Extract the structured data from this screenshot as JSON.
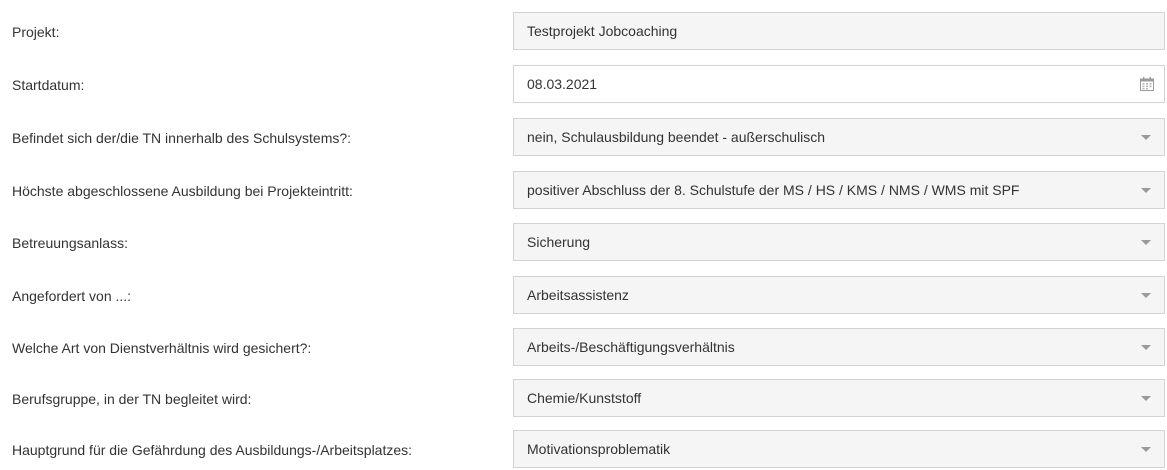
{
  "form": {
    "rows": [
      {
        "label": "Projekt:",
        "value": "Testprojekt Jobcoaching",
        "control": "text",
        "icon": ""
      },
      {
        "label": "Startdatum:",
        "value": "08.03.2021",
        "control": "date",
        "icon": "calendar-icon"
      },
      {
        "label": "Befindet sich der/die TN innerhalb des Schulsystems?:",
        "value": "nein, Schulausbildung beendet - außerschulisch",
        "control": "select",
        "icon": "chevron-down-icon"
      },
      {
        "label": "Höchste abgeschlossene Ausbildung bei Projekteintritt:",
        "value": "positiver Abschluss der 8. Schulstufe der MS / HS / KMS / NMS / WMS mit SPF",
        "control": "select",
        "icon": "chevron-down-icon"
      },
      {
        "label": "Betreuungsanlass:",
        "value": "Sicherung",
        "control": "select",
        "icon": "chevron-down-icon"
      },
      {
        "label": "Angefordert von ...:",
        "value": "Arbeitsassistenz",
        "control": "select",
        "icon": "chevron-down-icon"
      },
      {
        "label": "Welche Art von Dienstverhältnis wird gesichert?:",
        "value": "Arbeits-/Beschäftigungsverhältnis",
        "control": "select",
        "icon": "chevron-down-icon"
      },
      {
        "label": "Berufsgruppe, in der TN begleitet wird:",
        "value": "Chemie/Kunststoff",
        "control": "select",
        "icon": "chevron-down-icon"
      },
      {
        "label": "Hauptgrund für die Gefährdung des Ausbildungs-/Arbeitsplatzes:",
        "value": "Motivationsproblematik",
        "control": "select",
        "icon": "chevron-down-icon"
      }
    ]
  },
  "colors": {
    "field_readonly_bg": "#f5f5f5",
    "field_border": "#d3d3d3",
    "text": "#333333",
    "caret": "#9a9a9a"
  }
}
